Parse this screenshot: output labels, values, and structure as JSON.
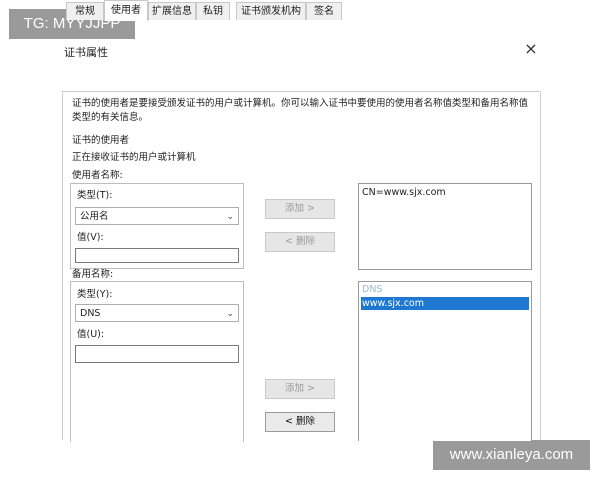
{
  "watermarks": {
    "top": "TG: MYYJJPP",
    "bottom": "www.xianleya.com"
  },
  "dialog": {
    "title": "证书属性",
    "close_glyph": "×"
  },
  "tabs": [
    {
      "label": "常规",
      "active": false
    },
    {
      "label": "使用者",
      "active": true
    },
    {
      "label": "扩展信息",
      "active": false
    },
    {
      "label": "私钥",
      "active": false
    },
    {
      "label": "证书颁发机构",
      "active": false
    },
    {
      "label": "签名",
      "active": false
    }
  ],
  "content": {
    "description": "证书的使用者是要接受颁发证书的用户或计算机。你可以输入证书中要使用的使用者名称值类型和备用名称值类型的有关信息。",
    "subject_heading": "证书的使用者",
    "subject_sub": "正在接收证书的用户或计算机"
  },
  "subject_name": {
    "group_label": "使用者名称:",
    "type_label": "类型(T):",
    "type_value": "公用名",
    "value_label": "值(V):",
    "value": "",
    "add_button": "添加 >",
    "remove_button": "< 删除",
    "list": [
      "CN=www.sjx.com"
    ]
  },
  "alt_name": {
    "group_label": "备用名称:",
    "type_label": "类型(Y):",
    "type_value": "DNS",
    "value_label": "值(U):",
    "value": "",
    "add_button": "添加 >",
    "remove_button": "< 删除",
    "list_header": "DNS",
    "list": [
      {
        "text": "www.sjx.com",
        "selected": true
      }
    ]
  },
  "colors": {
    "selection": "#1e78d2",
    "watermark_bg": "#9a9a9a"
  }
}
